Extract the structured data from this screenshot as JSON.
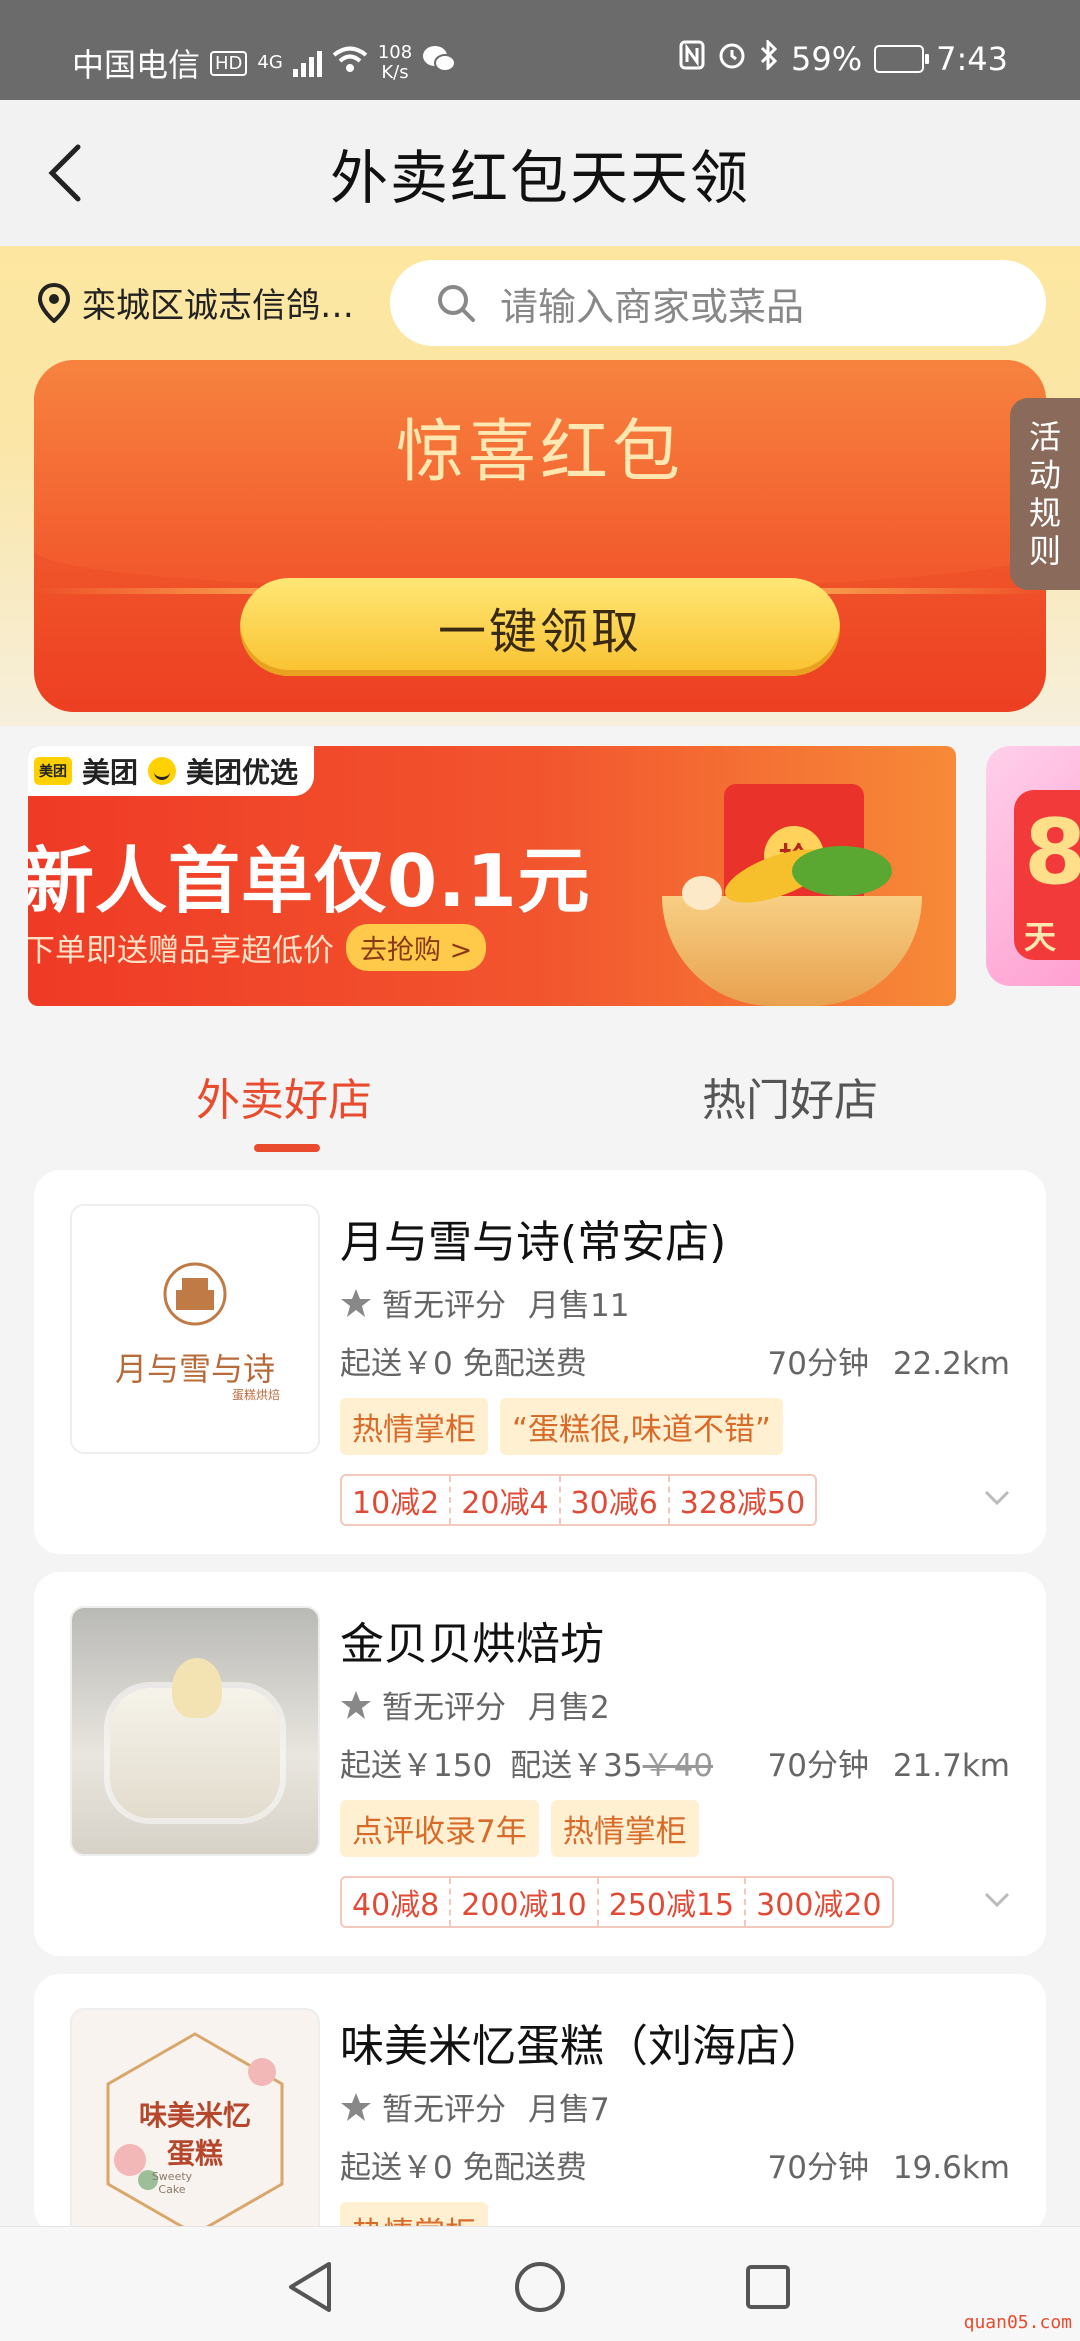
{
  "status_bar": {
    "carrier": "中国电信",
    "hd": "HD",
    "network": "4G",
    "speed_value": "108",
    "speed_unit": "K/s",
    "battery": "59%",
    "time": "7:43"
  },
  "title_bar": {
    "title": "外卖红包天天领"
  },
  "location_bar": {
    "location": "栾城区诚志信鸽…",
    "search_placeholder": "请输入商家或菜品"
  },
  "red_packet": {
    "title": "惊喜红包",
    "claim_label": "一键领取",
    "rules_label": "活动规则"
  },
  "banner": {
    "brand1": "美团",
    "brand1_logo": "美团",
    "brand2": "美团优选",
    "headline": "新人首单仅0.1元",
    "subline": "下单即送赠品享超低价",
    "cta": "去抢购 >",
    "seal": "抢",
    "next_banner_digit": "8",
    "next_banner_char": "天"
  },
  "tabs": [
    {
      "label": "外卖好店",
      "active": true
    },
    {
      "label": "热门好店",
      "active": false
    }
  ],
  "stores": [
    {
      "name": "月与雪与诗(常安店)",
      "logo_text": "月与雪与诗",
      "logo_sub": "蛋糕烘焙",
      "rating": "暂无评分",
      "monthly_sales": "月售11",
      "min_order": "起送￥0",
      "delivery_fee": "免配送费",
      "delivery_fee_original": "",
      "time": "70分钟",
      "distance": "22.2km",
      "tags": [
        "热情掌柜",
        "“蛋糕很,味道不错”"
      ],
      "discounts": [
        "10减2",
        "20减4",
        "30减6",
        "328减50"
      ]
    },
    {
      "name": "金贝贝烘焙坊",
      "rating": "暂无评分",
      "monthly_sales": "月售2",
      "min_order": "起送￥150",
      "delivery_fee": "配送￥35",
      "delivery_fee_original": "￥40",
      "time": "70分钟",
      "distance": "21.7km",
      "tags": [
        "点评收录7年",
        "热情掌柜"
      ],
      "discounts": [
        "40减8",
        "200减10",
        "250减15",
        "300减20"
      ]
    },
    {
      "name": "味美米忆蛋糕（刘海店）",
      "logo_text_line1": "味美米忆",
      "logo_text_line2": "蛋糕",
      "logo_sub": "Sweety Cake",
      "rating": "暂无评分",
      "monthly_sales": "月售7",
      "min_order": "起送￥0",
      "delivery_fee": "免配送费",
      "delivery_fee_original": "",
      "time": "70分钟",
      "distance": "19.6km",
      "tags": [
        "热情掌柜"
      ]
    }
  ],
  "colors": {
    "accent": "#e84b2d",
    "tag_bg": "#fff0d2",
    "tag_text": "#d96b2a"
  },
  "watermark": "quan05.com"
}
